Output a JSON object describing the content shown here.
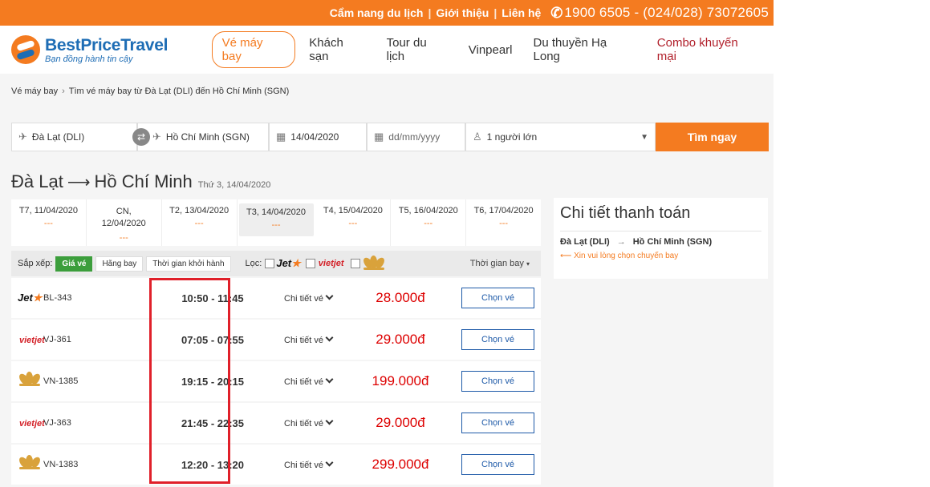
{
  "topbar": {
    "links": [
      "Cẩm nang du lịch",
      "Giới thiệu",
      "Liên hệ"
    ],
    "hotline": "1900 6505  -  (024/028) 73072605"
  },
  "header": {
    "brand": "BestPriceTravel",
    "slogan": "Bạn đồng hành tin cậy",
    "nav": [
      "Vé máy bay",
      "Khách sạn",
      "Tour du lịch",
      "Vinpearl",
      "Du thuyền Hạ Long",
      "Combo khuyến mại"
    ]
  },
  "breadcrumb": {
    "home": "Vé máy bay",
    "current": "Tìm vé máy bay từ Đà Lạt (DLI) đến Hồ Chí Minh (SGN)"
  },
  "search": {
    "from": "Đà Lạt (DLI)",
    "to": "Hồ Chí Minh (SGN)",
    "depart_date": "14/04/2020",
    "return_placeholder": "dd/mm/yyyy",
    "passengers": "1 người lớn",
    "button": "Tìm ngay"
  },
  "route": {
    "from_city": "Đà Lạt",
    "to_city": "Hồ Chí Minh",
    "date": "Thứ 3, 14/04/2020"
  },
  "date_tabs": [
    {
      "label": "T7, 11/04/2020",
      "price": "---"
    },
    {
      "label": "CN, 12/04/2020",
      "price": "---"
    },
    {
      "label": "T2, 13/04/2020",
      "price": "---"
    },
    {
      "label": "T3, 14/04/2020",
      "price": "---"
    },
    {
      "label": "T4, 15/04/2020",
      "price": "---"
    },
    {
      "label": "T5, 16/04/2020",
      "price": "---"
    },
    {
      "label": "T6, 17/04/2020",
      "price": "---"
    }
  ],
  "filter": {
    "sort_label": "Sắp xếp:",
    "sort_buttons": [
      "Giá vé",
      "Hãng bay",
      "Thời gian khởi hành"
    ],
    "filter_label": "Lọc:",
    "jetstar_logo": "Jet",
    "vietjet_logo": "vietjet",
    "sort_by": "Thời gian bay"
  },
  "flights": [
    {
      "airline": "jetstar",
      "code": "BL-343",
      "time": "10:50 - 11:45",
      "detail": "Chi tiết vé",
      "price": "28.000đ",
      "button": "Chọn vé"
    },
    {
      "airline": "vietjet",
      "code": "VJ-361",
      "time": "07:05 - 07:55",
      "detail": "Chi tiết vé",
      "price": "29.000đ",
      "button": "Chọn vé"
    },
    {
      "airline": "vietnam-airlines",
      "code": "VN-1385",
      "time": "19:15 - 20:15",
      "detail": "Chi tiết vé",
      "price": "199.000đ",
      "button": "Chọn vé"
    },
    {
      "airline": "vietjet",
      "code": "VJ-363",
      "time": "21:45 - 22:35",
      "detail": "Chi tiết vé",
      "price": "29.000đ",
      "button": "Chọn vé"
    },
    {
      "airline": "vietnam-airlines",
      "code": "VN-1383",
      "time": "12:20 - 13:20",
      "detail": "Chi tiết vé",
      "price": "299.000đ",
      "button": "Chọn vé"
    }
  ],
  "sidebar": {
    "title": "Chi tiết thanh toán",
    "from": "Đà Lạt (DLI)",
    "to": "Hồ Chí Minh (SGN)",
    "note": "Xin vui lòng chọn chuyến bay"
  },
  "colors": {
    "accent": "#f47b20",
    "brand_blue": "#1e6db5",
    "price_red": "#dd0000",
    "highlight_box": "#e0202a"
  }
}
